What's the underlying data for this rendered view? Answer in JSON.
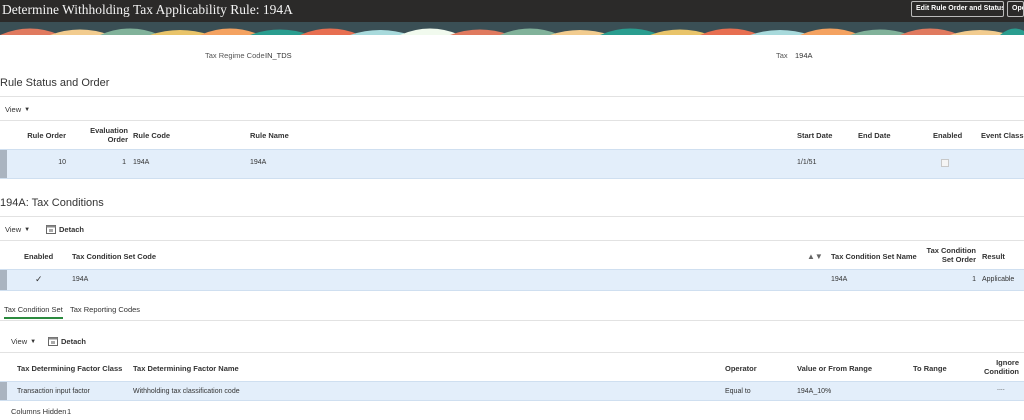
{
  "header": {
    "title": "Determine Withholding Tax Applicability Rule: 194A",
    "edit_button": "Edit Rule Order and Status",
    "open_button": "Ope"
  },
  "summary": {
    "regime_label": "Tax Regime Code",
    "regime_value": "IN_TDS",
    "tax_label": "Tax",
    "tax_value": "194A"
  },
  "rule_section": {
    "title": "Rule Status and Order",
    "view_label": "View",
    "columns": {
      "rule_order": "Rule Order",
      "eval_order_1": "Evaluation",
      "eval_order_2": "Order",
      "rule_code": "Rule Code",
      "rule_name": "Rule Name",
      "start_date": "Start Date",
      "end_date": "End Date",
      "enabled": "Enabled",
      "event_class": "Event Class"
    },
    "row": {
      "rule_order": "10",
      "eval_order": "1",
      "rule_code": "194A",
      "rule_name": "194A",
      "start_date": "1/1/51",
      "end_date": "",
      "enabled": true
    }
  },
  "conditions_section": {
    "title": "194A: Tax Conditions",
    "view_label": "View",
    "detach_label": "Detach",
    "columns": {
      "enabled": "Enabled",
      "set_code": "Tax Condition Set Code",
      "set_name": "Tax Condition Set Name",
      "set_order_1": "Tax Condition",
      "set_order_2": "Set Order",
      "result": "Result"
    },
    "row": {
      "enabled_mark": "✓",
      "set_code": "194A",
      "set_name": "194A",
      "set_order": "1",
      "result": "Applicable"
    }
  },
  "tabs": [
    {
      "label": "Tax Condition Set",
      "active": true
    },
    {
      "label": "Tax Reporting Codes",
      "active": false
    }
  ],
  "factor_section": {
    "view_label": "View",
    "detach_label": "Detach",
    "columns": {
      "factor_class": "Tax Determining Factor Class",
      "factor_name": "Tax Determining Factor Name",
      "operator": "Operator",
      "from_range": "Value or From Range",
      "to_range": "To Range",
      "ignore_1": "Ignore",
      "ignore_2": "Condition"
    },
    "row": {
      "factor_class": "Transaction input factor",
      "factor_name": "Withholding tax classification code",
      "operator": "Equal to",
      "from_range": "194A_10%",
      "to_range": "",
      "ignore": "...."
    },
    "columns_hidden_label": "Columns Hidden",
    "columns_hidden_value": "1"
  }
}
